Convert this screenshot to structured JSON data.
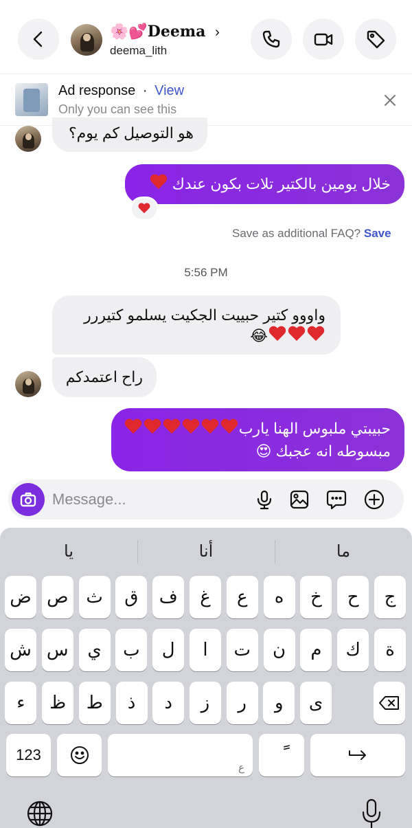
{
  "header": {
    "name": "🌸💕𝕯𝖊𝖊𝖒𝖆",
    "name_display": "Deema",
    "username": "deema_lith"
  },
  "ad": {
    "title": "Ad response",
    "dot": "·",
    "view": "View",
    "subtitle": "Only you can see this"
  },
  "messages": {
    "m1": "هو التوصيل كم يوم؟",
    "m2": "خلال يومين بالكتير تلات بكون عندك",
    "faq_text": "Save as additional FAQ?",
    "faq_save": "Save",
    "time": "5:56 PM",
    "m3_line1": "واووو كتير حبييت الجكيت يسلمو كتيررر",
    "m4": "راح اعتمدكم",
    "m5_line1": "حبيبتي ملبوس الهنا يارب",
    "m5_line2": "مبسوطه انه عجبك"
  },
  "composer": {
    "placeholder": "Message..."
  },
  "keyboard": {
    "suggestions": [
      "ما",
      "أنا",
      "يا"
    ],
    "row1": [
      "ج",
      "ح",
      "خ",
      "ه",
      "ع",
      "غ",
      "ف",
      "ق",
      "ث",
      "ص",
      "ض"
    ],
    "row2": [
      "ة",
      "ك",
      "م",
      "ن",
      "ت",
      "ا",
      "ل",
      "ب",
      "ي",
      "س",
      "ش"
    ],
    "row3": [
      "ى",
      "و",
      "ر",
      "ز",
      "د",
      "ذ",
      "ط",
      "ظ",
      "ء"
    ],
    "numbers_key": "123",
    "space_hint": "ع",
    "tanween_key": "ً"
  },
  "colors": {
    "accent_purple": "#8a24e6",
    "link_blue": "#3f56c9",
    "keyboard_bg": "#d2d4da"
  }
}
